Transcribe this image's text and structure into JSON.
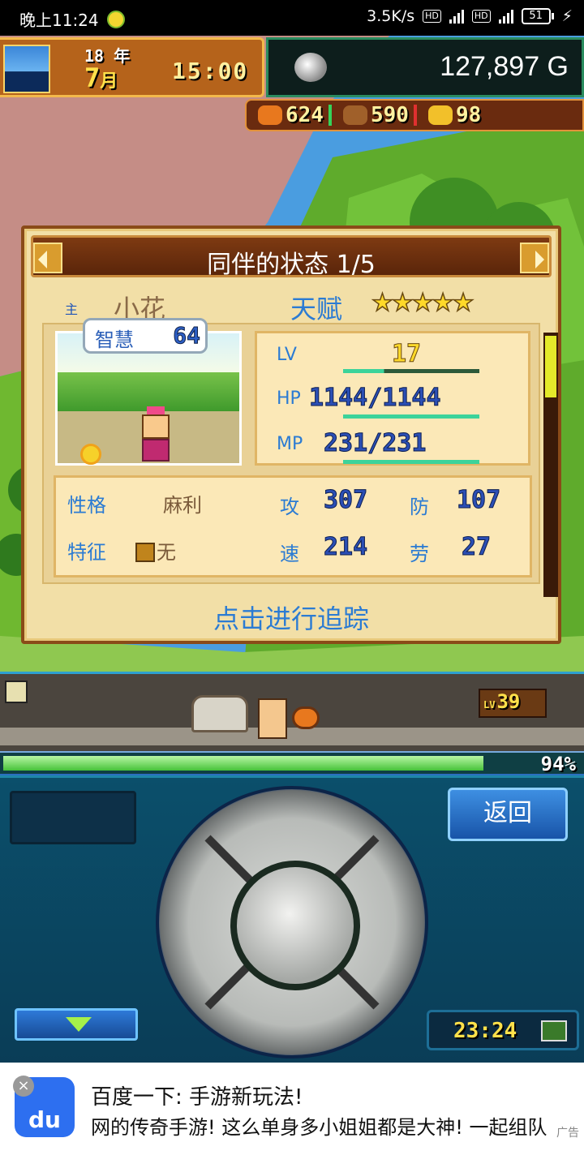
{
  "status_bar": {
    "time": "晚上11:24",
    "network_speed": "3.5K/s",
    "hd1": "HD",
    "hd2": "HD",
    "battery": "51"
  },
  "game": {
    "date": {
      "year": "18",
      "year_unit": "年",
      "month": "7",
      "month_unit": "月",
      "time": "15:00"
    },
    "money": "127,897 G",
    "resources": [
      {
        "icon": "meat-icon",
        "value": "624",
        "color": "#e8781e",
        "sep_color": "#35d35a"
      },
      {
        "icon": "wood-icon",
        "value": "590",
        "color": "#a0602a",
        "sep_color": "#e03030"
      },
      {
        "icon": "ore-icon",
        "value": "98",
        "color": "#f2c02a",
        "sep_color": "#6a2b0f"
      }
    ],
    "dialog": {
      "title": "同伴的状态 1/5",
      "main_tag": "主",
      "name": "小花",
      "talent_label": "天赋",
      "talent_stars": "★★★★★",
      "talent_level": 5,
      "bubble_label": "智慧",
      "bubble_value": "64",
      "lv_label": "LV",
      "lv_value": "17",
      "hp_label": "HP",
      "hp_value": "1144/1144",
      "hp_fraction": 1.0,
      "mp_label": "MP",
      "mp_value": "231/231",
      "mp_fraction": 1.0,
      "lv_bar_fraction": 0.3,
      "personality_label": "性格",
      "personality_value": "麻利",
      "trait_label": "特征",
      "trait_value": "无",
      "atk_label": "攻",
      "atk_value": "307",
      "def_label": "防",
      "def_value": "107",
      "spd_label": "速",
      "spd_value": "214",
      "labor_label": "劳",
      "labor_value": "27",
      "track_link": "点击进行追踪"
    },
    "road": {
      "level_prefix": "LV",
      "level": "39",
      "progress_text": "94%",
      "progress_fraction": 0.94
    },
    "controls": {
      "back_label": "返回",
      "clock": "23:24"
    }
  },
  "ad": {
    "logo_text": "du",
    "close": "×",
    "title": "百度一下: 手游新玩法!",
    "subtitle": "网的传奇手游! 这么单身多小姐姐都是大神! 一起组队",
    "tag": "广告"
  },
  "colors": {
    "accent_blue": "#2b7bd3",
    "hp_bar": "#3cd39a",
    "dialog_bg": "#f2dfa7",
    "title_bar": "#5a250a"
  }
}
